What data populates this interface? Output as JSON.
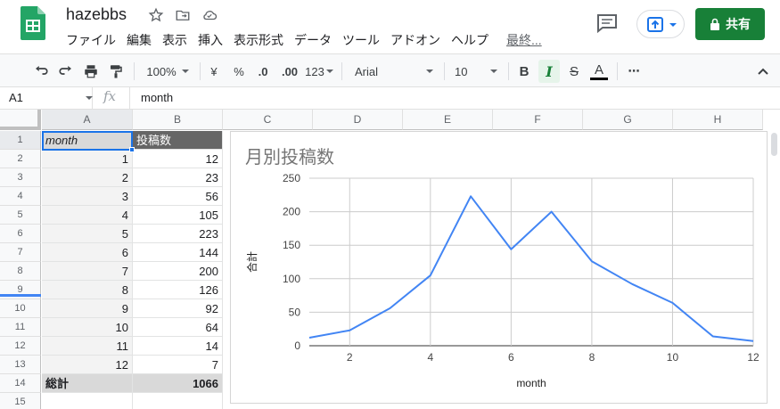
{
  "app": {
    "title": "hazebbs",
    "last_edit": "最終...",
    "share_label": "共有"
  },
  "menu": [
    "ファイル",
    "編集",
    "表示",
    "挿入",
    "表示形式",
    "データ",
    "ツール",
    "アドオン",
    "ヘルプ"
  ],
  "toolbar": {
    "zoom": "100%",
    "currency": "¥",
    "percent": "%",
    "dec_less": ".0",
    "dec_more": ".00",
    "number_format": "123",
    "font": "Arial",
    "font_size": "10",
    "bold": "B",
    "italic": "I",
    "strike": "S",
    "text_color": "A",
    "more": "⋯"
  },
  "formula_bar": {
    "name_box": "A1",
    "fx": "fx",
    "value": "month"
  },
  "columns": [
    "A",
    "B",
    "C",
    "D",
    "E",
    "F",
    "G",
    "H"
  ],
  "rows": [
    "1",
    "2",
    "3",
    "4",
    "5",
    "6",
    "7",
    "8",
    "9",
    "10",
    "11",
    "12",
    "13",
    "14",
    "15"
  ],
  "sheet": {
    "header": [
      "month",
      "投稿数"
    ],
    "data": [
      [
        "1",
        "12"
      ],
      [
        "2",
        "23"
      ],
      [
        "3",
        "56"
      ],
      [
        "4",
        "105"
      ],
      [
        "5",
        "223"
      ],
      [
        "6",
        "144"
      ],
      [
        "7",
        "200"
      ],
      [
        "8",
        "126"
      ],
      [
        "9",
        "92"
      ],
      [
        "10",
        "64"
      ],
      [
        "11",
        "14"
      ],
      [
        "12",
        "7"
      ]
    ],
    "total_label": "総計",
    "total_value": "1066"
  },
  "chart_data": {
    "type": "line",
    "title": "月別投稿数",
    "xlabel": "month",
    "ylabel": "合計",
    "x": [
      1,
      2,
      3,
      4,
      5,
      6,
      7,
      8,
      9,
      10,
      11,
      12
    ],
    "series": [
      {
        "values": [
          12,
          23,
          56,
          105,
          223,
          144,
          200,
          126,
          92,
          64,
          14,
          7
        ]
      }
    ],
    "xlim": [
      1,
      12
    ],
    "ylim": [
      0,
      250
    ],
    "xticks": [
      2,
      4,
      6,
      8,
      10,
      12
    ],
    "yticks": [
      0,
      50,
      100,
      150,
      200,
      250
    ],
    "grid": true,
    "line_color": "#4285f4"
  },
  "colors": {
    "accent": "#1a73e8",
    "share": "#188038",
    "header_dark": "#666666",
    "header_light": "#d9d9d9"
  }
}
